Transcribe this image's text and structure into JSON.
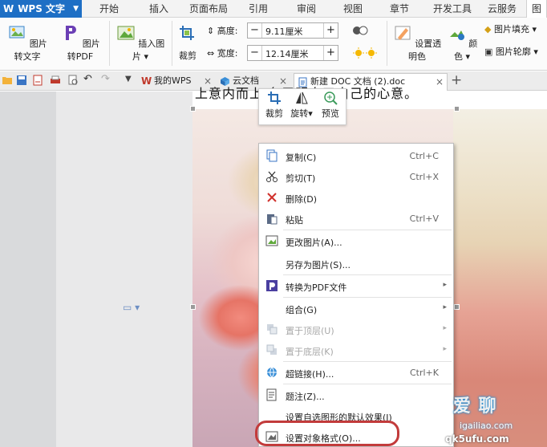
{
  "app": {
    "name": "WPS 文字"
  },
  "menu_tabs": [
    "开始",
    "插入",
    "页面布局",
    "引用",
    "审阅",
    "视图",
    "章节",
    "开发工具",
    "云服务",
    "图"
  ],
  "ribbon": {
    "pic_to_text": "图片转文字",
    "pic_to_pdf": "图片转PDF",
    "insert_picture": "插入图片",
    "crop": "裁剪",
    "height_label": "高度:",
    "height_value": "9.11厘米",
    "width_label": "宽度:",
    "width_value": "12.14厘米",
    "set_transparent": "设置透明色",
    "color": "颜色",
    "pic_fill": "图片填充",
    "pic_outline": "图片轮廓",
    "minus": "−",
    "plus": "+"
  },
  "doc_tabs": [
    {
      "label": "我的WPS"
    },
    {
      "label": "云文档"
    },
    {
      "label": "新建 DOC 文档 (2).doc"
    }
  ],
  "doc_text": "上意内而上    冬于明白了自己的心意。",
  "mini_toolbar": {
    "crop": "裁剪",
    "rotate": "旋转",
    "preview": "预览"
  },
  "context_menu": [
    {
      "label": "复制(C)",
      "shortcut": "Ctrl+C"
    },
    {
      "label": "剪切(T)",
      "shortcut": "Ctrl+X"
    },
    {
      "label": "删除(D)"
    },
    {
      "label": "粘贴",
      "shortcut": "Ctrl+V"
    },
    {
      "label": "更改图片(A)..."
    },
    {
      "label": "另存为图片(S)..."
    },
    {
      "label": "转换为PDF文件"
    },
    {
      "label": "组合(G)"
    },
    {
      "label": "置于顶层(U)"
    },
    {
      "label": "置于底层(K)"
    },
    {
      "label": "超链接(H)...",
      "shortcut": "Ctrl+K"
    },
    {
      "label": "题注(Z)..."
    },
    {
      "label": "设置自选图形的默认效果(I)"
    },
    {
      "label": "设置对象格式(O)..."
    }
  ],
  "watermark": {
    "brand": "爱 聊",
    "site": "igailiao.com",
    "site2": "qk5ufu.com"
  },
  "colors": {
    "accent": "#1e6fc5",
    "highlight": "#c23b3b"
  }
}
